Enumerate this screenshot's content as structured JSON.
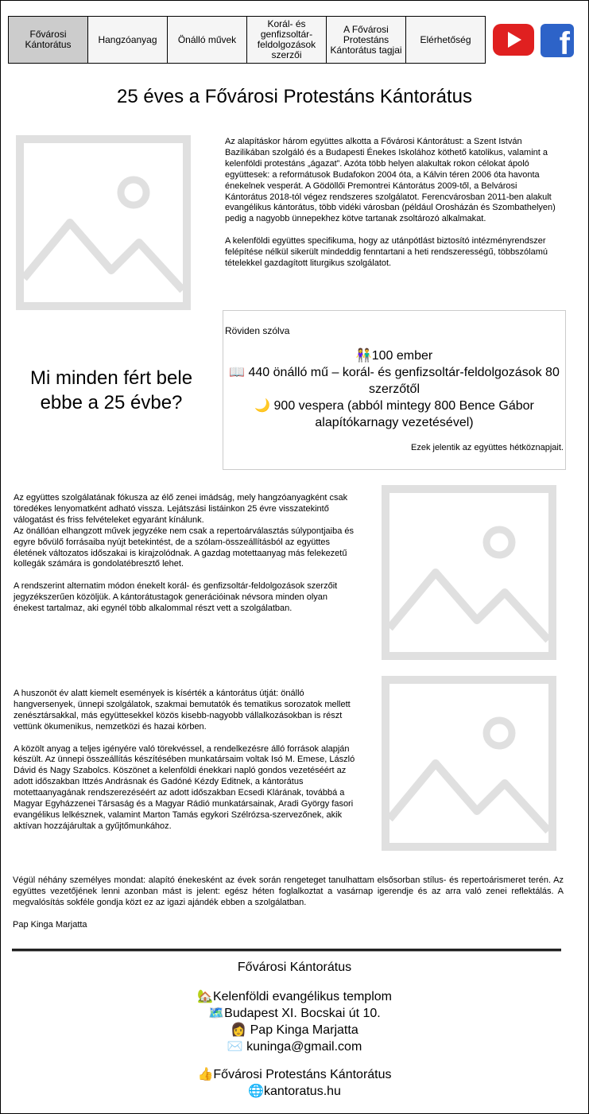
{
  "nav": {
    "tabs": [
      {
        "label": "Fővárosi Kántorátus"
      },
      {
        "label": "Hangzóanyag"
      },
      {
        "label": "Önálló művek"
      },
      {
        "label": "Korál- és genfizsoltár-feldolgozások szerzői"
      },
      {
        "label": "A Fővárosi Protestáns Kántorátus tagjai"
      },
      {
        "label": "Elérhetőség"
      }
    ],
    "youtube_icon": "youtube-icon",
    "facebook_icon": "facebook-icon"
  },
  "page_title": "25 éves a Fővárosi Protestáns Kántorátus",
  "intro": {
    "p1": "Az alapításkor három együttes alkotta a Fővárosi Kántorátust: a Szent István Bazilikában szolgáló és a Budapesti Énekes Iskolához köthető katolikus, valamint a kelenföldi protestáns „ágazat”. Azóta több helyen alakultak rokon célokat ápoló együttesek: a reformátusok Budafokon 2004 óta, a Kálvin téren 2006 óta havonta énekelnek vesperát. A Gödöllői Premontrei Kántorátus 2009-től, a Belvárosi Kántorátus 2018-tól végez rendszeres szolgálatot. Ferencvárosban 2011-ben alakult evangélikus kántorátus, több vidéki városban (például Orosházán és Szombathelyen) pedig a nagyobb ünnepekhez kötve tartanak zsoltározó alkalmakat.",
    "p2": "A kelenföldi együttes specifikuma, hogy az utánpótlást biztosító intézményrendszer felépítése nélkül sikerült mindeddig fenntartani a heti rendszerességű, többszólamú tételekkel gazdagított liturgikus szolgálatot."
  },
  "question": "Mi minden fért bele ebbe a 25 évbe?",
  "summary": {
    "label": "Röviden szólva",
    "stat1": "👫100 ember",
    "stat2": "📖 440 önálló mű – korál- és genfizsoltár-feldolgozások 80 szerzőtől",
    "stat3": "🌙 900 vespera (abból mintegy 800 Bence Gábor alapítókarnagy vezetésével)",
    "footer": "Ezek jelentik az együttes hétköznapjait."
  },
  "section2": {
    "p1": "Az együttes szolgálatának fókusza az élő zenei imádság, mely hangzóanyagként csak töredékes lenyomatként adható vissza. Lejátszási listáinkon 25 évre visszatekintő válogatást és friss felvételeket egyaránt kínálunk.",
    "p1b": "Az önállóan elhangzott művek jegyzéke nem csak a repertoárválasztás súlypontjaiba és egyre bővülő forrásaiba nyújt betekintést, de a szólam-összeállításból az együttes életének változatos időszakai is kirajzolódnak. A gazdag motettaanyag más felekezetű kollegák számára is gondolatébresztő lehet.",
    "p2": "A rendszerint alternatim módon énekelt korál- és genfizsoltár-feldolgozások szerzőit jegyzékszerűen közöljük. A kántorátustagok generációinak névsora minden olyan énekest tartalmaz, aki egynél több alkalommal részt vett a szolgálatban."
  },
  "section3": {
    "p1": "A huszonöt év alatt kiemelt események is kísérték a kántorátus útját: önálló hangversenyek, ünnepi szolgálatok, szakmai bemutatók és tematikus sorozatok mellett zenésztársakkal, más együttesekkel közös kisebb-nagyobb vállalkozásokban is részt vettünk ökumenikus, nemzetközi és hazai körben.",
    "p2": "A közölt anyag a teljes igényére való törekvéssel, a rendelkezésre álló források alapján készült. Az ünnepi összeállítás készítésében munkatársaim voltak Isó M. Emese, László Dávid és Nagy Szabolcs. Köszönet a kelenföldi énekkari napló gondos vezetéséért az adott időszakban Ittzés Andrásnak és Gadóné Kézdy Editnek, a kántorátus motettaanyagának rendszerezéséért az adott időszakban Ecsedi Klárának, továbbá a Magyar Egyházzenei Társaság és a Magyar Rádió munkatársainak, Aradi György fasori evangélikus lelkésznek, valamint Marton Tamás egykori Szélrózsa-szervezőnek, akik aktívan hozzájárultak a gyűjtőmunkához."
  },
  "closing": {
    "p1": "Végül néhány személyes mondat: alapító énekesként az évek során rengeteget tanulhattam elsősorban stílus- és repertoárismeret terén. Az együttes vezetőjének lenni azonban mást is jelent: egész héten foglalkoztat a vasárnap igerendje és az arra való zenei reflektálás. A megvalósítás sokféle gondja közt ez az igazi ajándék ebben a szolgálatban.",
    "signature": "Pap Kinga Marjatta"
  },
  "footer": {
    "heading": "Fővárosi Kántorátus",
    "line1": "🏡Kelenföldi evangélikus templom",
    "line2": "🗺️Budapest XI. Bocskai út 10.",
    "line3": "👩 Pap Kinga Marjatta",
    "line4": "✉️ kuninga@gmail.com",
    "line5": "👍Fővárosi Protestáns Kántorátus",
    "line6": "🌐kantoratus.hu"
  }
}
